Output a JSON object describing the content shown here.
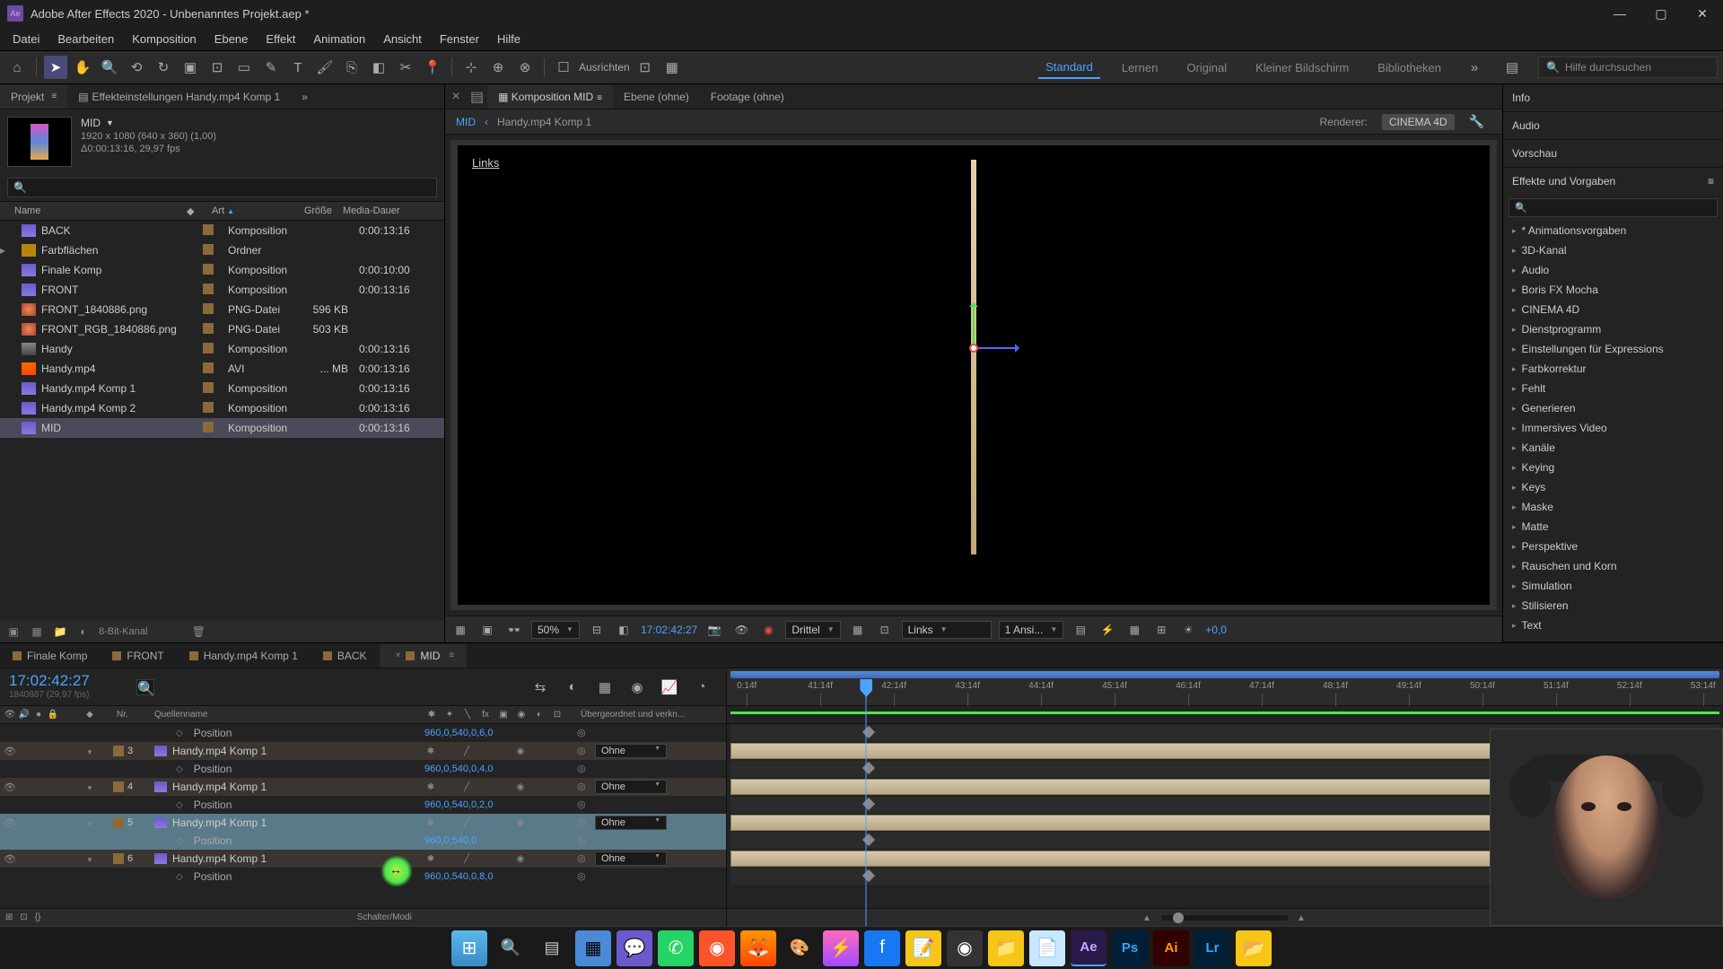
{
  "window": {
    "app_badge": "Ae",
    "title": "Adobe After Effects 2020 - Unbenanntes Projekt.aep *"
  },
  "menu": [
    "Datei",
    "Bearbeiten",
    "Komposition",
    "Ebene",
    "Effekt",
    "Animation",
    "Ansicht",
    "Fenster",
    "Hilfe"
  ],
  "toolbar": {
    "align": "Ausrichten",
    "workspaces": [
      "Standard",
      "Lernen",
      "Original",
      "Kleiner Bildschirm",
      "Bibliotheken"
    ],
    "help_placeholder": "Hilfe durchsuchen"
  },
  "project_panel": {
    "tab_project": "Projekt",
    "tab_effect": "Effekteinstellungen Handy.mp4 Komp 1",
    "comp_name": "MID",
    "line1": "1920 x 1080 (640 x 360) (1,00)",
    "line2": "Δ0:00:13:16, 29,97 fps",
    "cols": {
      "name": "Name",
      "type": "Art",
      "size": "Größe",
      "dur": "Media-Dauer"
    },
    "rows": [
      {
        "name": "BACK",
        "icon": "comp",
        "type": "Komposition",
        "size": "",
        "dur": "0:00:13:16",
        "tw": false
      },
      {
        "name": "Farbflächen",
        "icon": "folder",
        "type": "Ordner",
        "size": "",
        "dur": "",
        "tw": true
      },
      {
        "name": "Finale Komp",
        "icon": "comp",
        "type": "Komposition",
        "size": "",
        "dur": "0:00:10:00",
        "tw": false
      },
      {
        "name": "FRONT",
        "icon": "comp",
        "type": "Komposition",
        "size": "",
        "dur": "0:00:13:16",
        "tw": false
      },
      {
        "name": "FRONT_1840886.png",
        "icon": "png",
        "type": "PNG-Datei",
        "size": "596 KB",
        "dur": "",
        "tw": false
      },
      {
        "name": "FRONT_RGB_1840886.png",
        "icon": "png",
        "type": "PNG-Datei",
        "size": "503 KB",
        "dur": "",
        "tw": false
      },
      {
        "name": "Handy",
        "icon": "video",
        "type": "Komposition",
        "size": "",
        "dur": "0:00:13:16",
        "tw": false
      },
      {
        "name": "Handy.mp4",
        "icon": "avi",
        "type": "AVI",
        "size": "... MB",
        "dur": "0:00:13:16",
        "tw": false
      },
      {
        "name": "Handy.mp4 Komp 1",
        "icon": "comp",
        "type": "Komposition",
        "size": "",
        "dur": "0:00:13:16",
        "tw": false
      },
      {
        "name": "Handy.mp4 Komp 2",
        "icon": "comp",
        "type": "Komposition",
        "size": "",
        "dur": "0:00:13:16",
        "tw": false
      },
      {
        "name": "MID",
        "icon": "comp",
        "type": "Komposition",
        "size": "",
        "dur": "0:00:13:16",
        "tw": false,
        "selected": true
      }
    ],
    "bpc": "8-Bit-Kanal"
  },
  "comp_panel": {
    "tab_comp": "Komposition MID",
    "tab_layer": "Ebene (ohne)",
    "tab_footage": "Footage (ohne)",
    "crumb_root": "MID",
    "crumb_child": "Handy.mp4 Komp 1",
    "renderer_lbl": "Renderer:",
    "renderer_val": "CINEMA 4D",
    "view_label": "Links",
    "foot": {
      "zoom": "50%",
      "tc": "17:02:42:27",
      "res": "Drittel",
      "view": "Links",
      "views": "1 Ansi...",
      "exposure": "+0,0"
    }
  },
  "right_panel": {
    "info": "Info",
    "audio": "Audio",
    "preview": "Vorschau",
    "effects": "Effekte und Vorgaben",
    "categories": [
      "* Animationsvorgaben",
      "3D-Kanal",
      "Audio",
      "Boris FX Mocha",
      "CINEMA 4D",
      "Dienstprogramm",
      "Einstellungen für Expressions",
      "Farbkorrektur",
      "Fehlt",
      "Generieren",
      "Immersives Video",
      "Kanäle",
      "Keying",
      "Keys",
      "Maske",
      "Matte",
      "Perspektive",
      "Rauschen und Korn",
      "Simulation",
      "Stilisieren",
      "Text"
    ]
  },
  "timeline": {
    "tabs": [
      "Finale Komp",
      "FRONT",
      "Handy.mp4 Komp 1",
      "BACK",
      "MID"
    ],
    "active_tab": 4,
    "tc": "17:02:42:27",
    "tc_sub": "1840887 (29,97 fps)",
    "col_nr": "Nr.",
    "col_src": "Quellenname",
    "col_parent": "Übergeordnet und verkn...",
    "parent_none": "Ohne",
    "layers": [
      {
        "num": "",
        "name": "Position",
        "type": "prop",
        "val": "960,0,540,0,6,0"
      },
      {
        "num": "3",
        "name": "Handy.mp4 Komp 1",
        "type": "layer"
      },
      {
        "num": "",
        "name": "Position",
        "type": "prop",
        "val": "960,0,540,0,4,0"
      },
      {
        "num": "4",
        "name": "Handy.mp4 Komp 1",
        "type": "layer"
      },
      {
        "num": "",
        "name": "Position",
        "type": "prop",
        "val": "960,0,540,0,2,0"
      },
      {
        "num": "5",
        "name": "Handy.mp4 Komp 1",
        "type": "layer",
        "selected": true
      },
      {
        "num": "",
        "name": "Position",
        "type": "prop",
        "val": "960,0,540,0",
        "selected": true
      },
      {
        "num": "6",
        "name": "Handy.mp4 Komp 1",
        "type": "layer"
      },
      {
        "num": "",
        "name": "Position",
        "type": "prop",
        "val": "960,0,540,0,8,0"
      }
    ],
    "switches": "Schalter/Modi",
    "ruler_ticks": [
      "0:14f",
      "41:14f",
      "42:14f",
      "43:14f",
      "44:14f",
      "45:14f",
      "46:14f",
      "47:14f",
      "48:14f",
      "49:14f",
      "50:14f",
      "51:14f",
      "52:14f",
      "53:14f"
    ],
    "playhead_pct": 14
  },
  "taskbar": {
    "items": [
      "win",
      "search",
      "tasks",
      "edge",
      "teams",
      "whatsapp",
      "brave",
      "firefox",
      "figma",
      "messenger",
      "facebook",
      "notes",
      "obs",
      "files",
      "sticky",
      "ae",
      "ps",
      "ai",
      "lr",
      "other"
    ]
  }
}
